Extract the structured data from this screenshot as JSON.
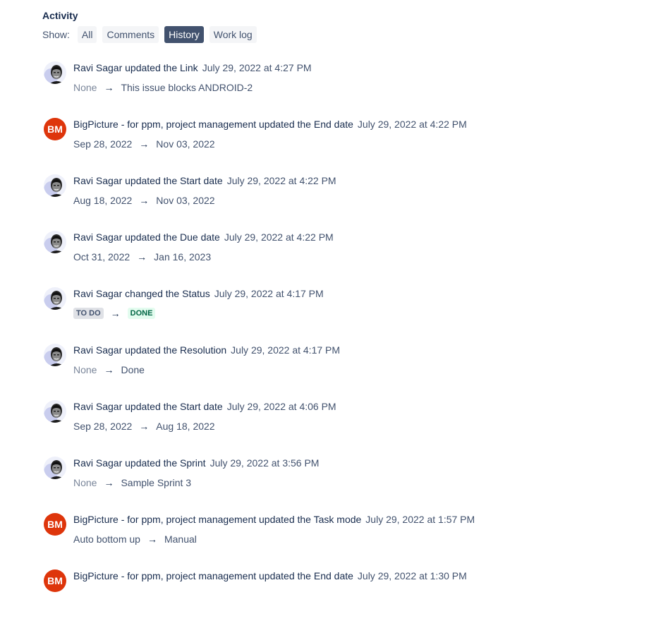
{
  "activity": {
    "title": "Activity",
    "show_label": "Show:",
    "filters": [
      "All",
      "Comments",
      "History",
      "Work log"
    ],
    "active_filter": "History"
  },
  "entries": [
    {
      "avatar": "photo",
      "head": "Ravi Sagar updated the Link",
      "time": "July 29, 2022 at 4:27 PM",
      "from": "None",
      "to": "This issue blocks ANDROID-2"
    },
    {
      "avatar": "BM",
      "head": "BigPicture - for ppm, project management updated the End date",
      "time": "July 29, 2022 at 4:22 PM",
      "from": "Sep 28, 2022",
      "to": "Nov 03, 2022"
    },
    {
      "avatar": "photo",
      "head": "Ravi Sagar updated the Start date",
      "time": "July 29, 2022 at 4:22 PM",
      "from": "Aug 18, 2022",
      "to": "Nov 03, 2022"
    },
    {
      "avatar": "photo",
      "head": "Ravi Sagar updated the Due date",
      "time": "July 29, 2022 at 4:22 PM",
      "from": "Oct 31, 2022",
      "to": "Jan 16, 2023"
    },
    {
      "avatar": "photo",
      "head": "Ravi Sagar changed the Status",
      "time": "July 29, 2022 at 4:17 PM",
      "from": "TO DO",
      "to": "DONE",
      "lozenge": true
    },
    {
      "avatar": "photo",
      "head": "Ravi Sagar updated the Resolution",
      "time": "July 29, 2022 at 4:17 PM",
      "from": "None",
      "to": "Done"
    },
    {
      "avatar": "photo",
      "head": "Ravi Sagar updated the Start date",
      "time": "July 29, 2022 at 4:06 PM",
      "from": "Sep 28, 2022",
      "to": "Aug 18, 2022"
    },
    {
      "avatar": "photo",
      "head": "Ravi Sagar updated the Sprint",
      "time": "July 29, 2022 at 3:56 PM",
      "from": "None",
      "to": "Sample Sprint 3"
    },
    {
      "avatar": "BM",
      "head": "BigPicture - for ppm, project management updated the Task mode",
      "time": "July 29, 2022 at 1:57 PM",
      "from": "Auto bottom up",
      "to": "Manual"
    },
    {
      "avatar": "BM",
      "head": "BigPicture - for ppm, project management updated the End date",
      "time": "July 29, 2022 at 1:30 PM",
      "from": "",
      "to": ""
    }
  ],
  "arrow_glyph": "→"
}
